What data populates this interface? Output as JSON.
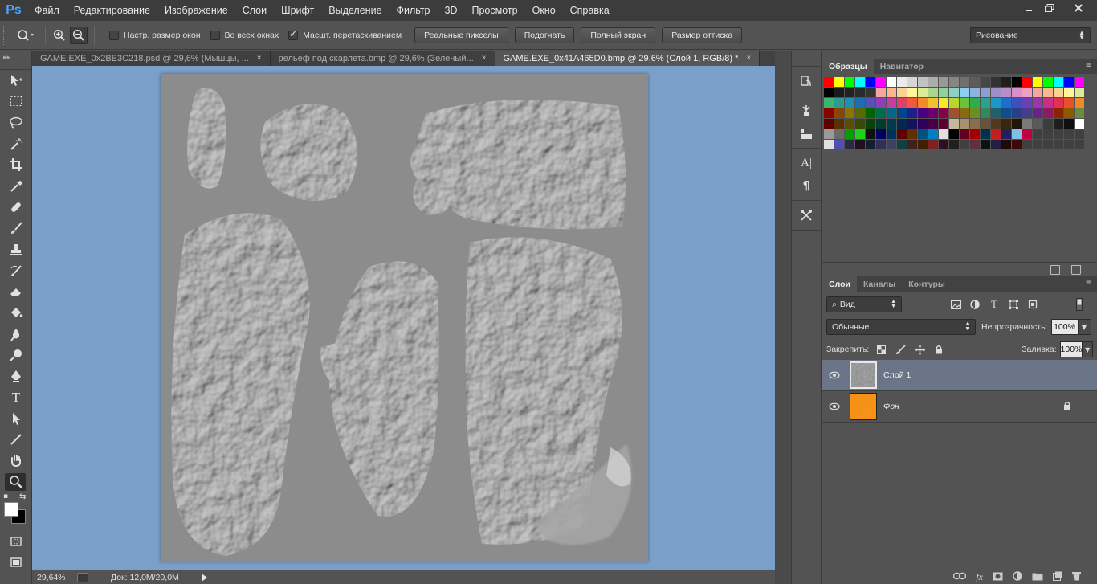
{
  "app": {
    "logo": "Ps",
    "menu": [
      "Файл",
      "Редактирование",
      "Изображение",
      "Слои",
      "Шрифт",
      "Выделение",
      "Фильтр",
      "3D",
      "Просмотр",
      "Окно",
      "Справка"
    ],
    "window_controls": {
      "minimize": "minimize-icon",
      "restore": "restore-icon",
      "close": "close-icon"
    }
  },
  "options_bar": {
    "tool_icon": "zoom-icon",
    "checkboxes": [
      {
        "label": "Настр. размер окон",
        "checked": false
      },
      {
        "label": "Во всех окнах",
        "checked": false
      },
      {
        "label": "Масшт. перетаскиванием",
        "checked": true
      }
    ],
    "buttons": [
      "Реальные пикселы",
      "Подогнать",
      "Полный экран",
      "Размер оттиска"
    ],
    "workspace": "Рисование"
  },
  "tabs": [
    {
      "label": "GAME.EXE_0x2BE3C218.psd @ 29,6% (Мышцы, ...",
      "close": "×",
      "active": false
    },
    {
      "label": "рельеф под скарлета.bmp @ 29,6% (Зеленый...",
      "close": "×",
      "active": false
    },
    {
      "label": "GAME.EXE_0x41A465D0.bmp @ 29,6% (Слой 1, RGB/8) *",
      "close": "×",
      "active": true
    }
  ],
  "status": {
    "zoom": "29,64%",
    "doc_info": "Док: 12,0M/20,0M"
  },
  "swatches_panel": {
    "tabs": [
      "Образцы",
      "Навигатор"
    ],
    "colors": [
      "#ff0000",
      "#ffff00",
      "#00ff00",
      "#00ffff",
      "#0000ff",
      "#ff00ff",
      "#ffffff",
      "#ebebeb",
      "#d6d6d6",
      "#c2c2c2",
      "#adadad",
      "#999999",
      "#858585",
      "#707070",
      "#5c5c5c",
      "#474747",
      "#333333",
      "#1f1f1f",
      "#000000",
      "#ff0000",
      "#ffff00",
      "#00ff00",
      "#00ffff",
      "#0000ff",
      "#ff00ff",
      "#000000",
      "#1a1a1a",
      "#222222",
      "#2a2a2a",
      "#333333",
      "#f4a6a0",
      "#f7b98d",
      "#fbd390",
      "#fff69a",
      "#dbec96",
      "#a8d78c",
      "#8ed39a",
      "#8fd2c4",
      "#8ccfee",
      "#8cb4e0",
      "#8e9fd3",
      "#a08ec7",
      "#b98ec7",
      "#d890c6",
      "#f19ec4",
      "#f4a6a0",
      "#f7b98d",
      "#fbd390",
      "#fff69a",
      "#dbec96",
      "#3cb371",
      "#2e9b8f",
      "#1e90b0",
      "#1a6fb5",
      "#5a4fb5",
      "#8f3fb5",
      "#c23fa0",
      "#e0406a",
      "#ef5a3c",
      "#f08c2e",
      "#f5c02e",
      "#f6e82e",
      "#b8d62e",
      "#6cc23a",
      "#2fad4e",
      "#26a38a",
      "#1d97c4",
      "#1f6ec9",
      "#3e4fc0",
      "#6b3fb7",
      "#9a37ad",
      "#c82f8a",
      "#e23052",
      "#e85030",
      "#ee8a28",
      "#8b0000",
      "#8b4500",
      "#8b7500",
      "#556b00",
      "#006400",
      "#006b4f",
      "#00688b",
      "#00468b",
      "#1f1f8b",
      "#4b0082",
      "#6b006b",
      "#8b0045",
      "#a0522d",
      "#8b6914",
      "#6b8e23",
      "#2e8b57",
      "#20606b",
      "#104e8b",
      "#27408b",
      "#483d8b",
      "#68228b",
      "#8b1c62",
      "#8b2500",
      "#8b5a00",
      "#6e8b3d",
      "#5c0000",
      "#5c2e00",
      "#5c4d00",
      "#38470a",
      "#0a420a",
      "#003d2e",
      "#003a4d",
      "#002a52",
      "#14145c",
      "#30005a",
      "#470047",
      "#5c002e",
      "#c8b89a",
      "#a89070",
      "#8a6e4e",
      "#6b5234",
      "#50391f",
      "#382610",
      "#211508",
      "#7a7a7a",
      "#5a5a5a",
      "#3c3c3c",
      "#1e1e1e",
      "#0f0f0f",
      "#ffffff",
      "#9a9a9a",
      "#6a6a6a",
      "#00a000",
      "#20d020",
      "#101010",
      "#000060",
      "#003060",
      "#600000",
      "#603000",
      "#005080",
      "#0080c0",
      "#e0e0e0",
      "#000000",
      "#600020",
      "#a00000",
      "#003050",
      "#c02020",
      "#202060",
      "#80c0e0",
      "#c00040",
      "#404040",
      "#404040",
      "#404040",
      "#404040",
      "#404040",
      "#e0e0e0",
      "#5050b0",
      "#2a2a40",
      "#201020",
      "#102030",
      "#303050",
      "#404060",
      "#104040",
      "#402020",
      "#402000",
      "#802020",
      "#301020",
      "#202020",
      "#404040",
      "#603040",
      "#101010",
      "#202040",
      "#200808",
      "#400808",
      "#404040",
      "#404040",
      "#404040",
      "#404040",
      "#404040",
      "#404040"
    ]
  },
  "dock": [
    "history-icon",
    "brush-preset-icon",
    "clone-source-icon",
    "character-icon",
    "paragraph-icon",
    "tool-presets-icon"
  ],
  "layers_panel": {
    "tabs": [
      "Слои",
      "Каналы",
      "Контуры"
    ],
    "filter": "Вид",
    "blend_mode": "Обычные",
    "opacity_label": "Непрозрачность:",
    "opacity": "100%",
    "lock_label": "Закрепить:",
    "fill_label": "Заливка:",
    "fill": "100%",
    "layers": [
      {
        "name": "Слой 1",
        "selected": true,
        "italic": false,
        "locked": false
      },
      {
        "name": "Фон",
        "selected": false,
        "italic": true,
        "locked": true
      }
    ],
    "footer_icons": [
      "link-icon",
      "fx-icon",
      "mask-icon",
      "adjustment-icon",
      "folder-icon",
      "new-layer-icon",
      "trash-icon"
    ],
    "footer_fx": "fx"
  },
  "colors": {
    "canvas_bg": "#7a9fc8",
    "panel_bg": "#535353",
    "selected_layer": "#6b7587",
    "background_layer": "#ff8c00",
    "logo": "#4aa3ff"
  }
}
